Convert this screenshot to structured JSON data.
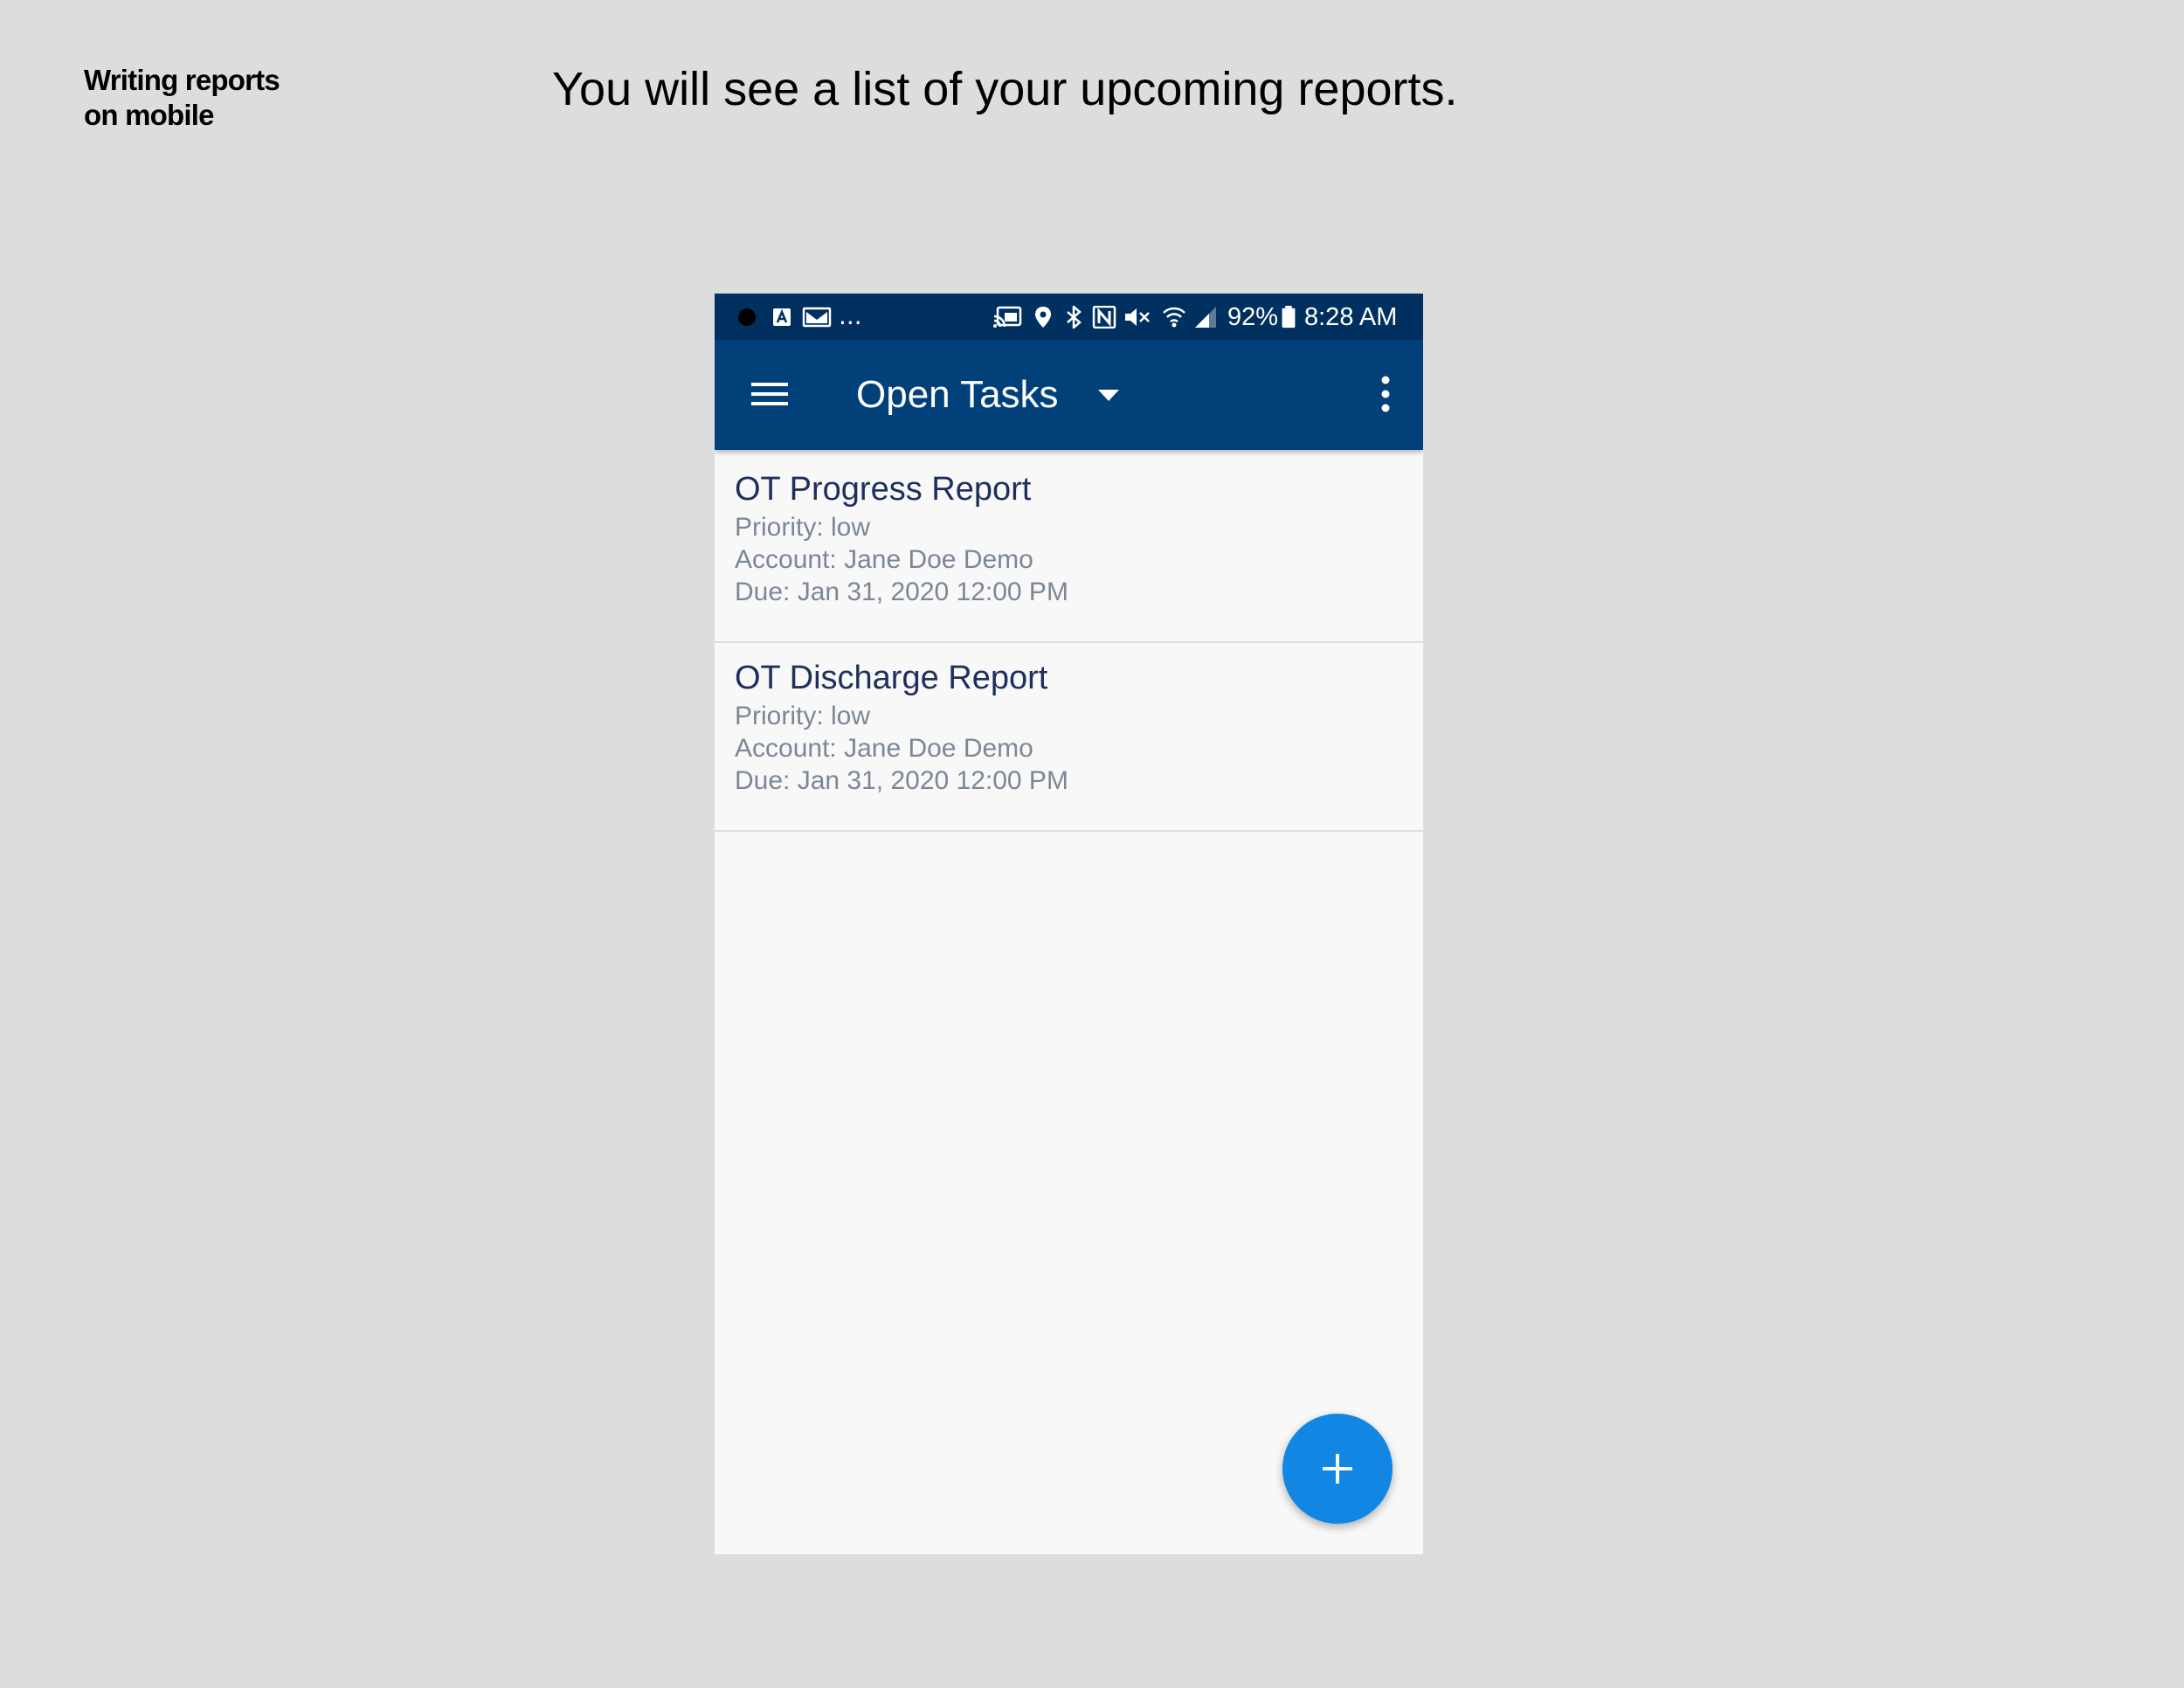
{
  "slide": {
    "section_label_line1": "Writing reports",
    "section_label_line2": "on mobile",
    "headline": "You will see a list of your upcoming reports."
  },
  "status_bar": {
    "battery_percent": "92%",
    "time": "8:28 AM",
    "overflow": "...",
    "icons": [
      "record-dot",
      "app-a",
      "gmail",
      "cast",
      "location",
      "bluetooth",
      "nfc",
      "mute",
      "wifi",
      "signal",
      "battery"
    ]
  },
  "toolbar": {
    "title": "Open Tasks",
    "icons": [
      "hamburger-menu",
      "dropdown-caret",
      "more-vertical"
    ]
  },
  "tasks": [
    {
      "title": "OT Progress Report",
      "priority": "Priority: low",
      "account": "Account: Jane Doe Demo",
      "due": "Due: Jan 31, 2020 12:00 PM"
    },
    {
      "title": "OT Discharge Report",
      "priority": "Priority: low",
      "account": "Account: Jane Doe Demo",
      "due": "Due: Jan 31, 2020 12:00 PM"
    }
  ],
  "fab": {
    "icon": "plus",
    "color": "#1186e3"
  },
  "colors": {
    "status_bar": "#00305f",
    "toolbar": "#02407a",
    "task_title": "#1e2f5b",
    "task_meta": "#7b8796",
    "page_background": "#dcdddf"
  }
}
